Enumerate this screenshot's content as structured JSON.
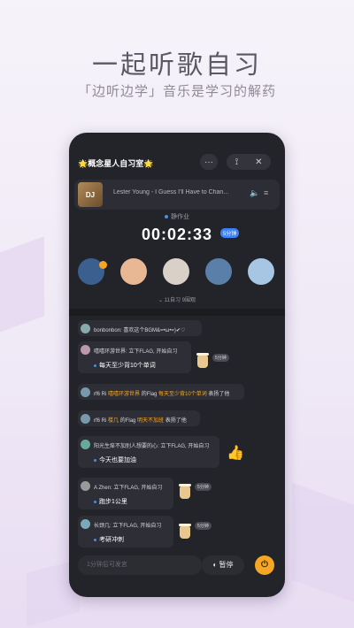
{
  "hero": {
    "title": "一起听歌自习",
    "subtitle": "「边听边学」音乐是学习的解药"
  },
  "room": {
    "title": "🌟概念星人自习室🌟",
    "more_label": "···",
    "pin_label": "⟟",
    "close_label": "✕"
  },
  "music": {
    "cover_text": "DJ",
    "track": "Lester Young - I Guess I'll Have to Chan...",
    "volume_icon": "speaker-icon",
    "list_icon": "list-icon"
  },
  "study": {
    "mode": "静作业",
    "timer": "00:02:33",
    "timer_badge": "5分钟",
    "stats": "11自习 9围观",
    "avatar_colors": [
      "#3b5f8f",
      "#e8b894",
      "#d9d0c7",
      "#5a7fa8",
      "#a7c6e4"
    ]
  },
  "chat": {
    "messages": [
      {
        "user": "bonbonbon",
        "text": "bonbonbon: 喜欢这个BGM&=•ω•=)✔♡"
      },
      {
        "user": "嘻嘻环游世界",
        "text": "嘻嘻环游世界: 立下FLAG, 开始自习",
        "sub": "每天至少背10个单词",
        "tag": "5分钟"
      },
      {
        "user": "rf6",
        "text_a": "rf6 Ri ",
        "hl": "嘻嘻环游世界",
        "text_b": " 的Flag ",
        "hl2": "每天至少背10个单词",
        "text_c": " 表扬了他"
      },
      {
        "user": "rf6",
        "text_a": "rf6 Ri ",
        "hl": "楼几",
        "text_b": " 的Flag ",
        "hl2": "明天不加班",
        "text_c": " 表扬了他"
      },
      {
        "user": "阳光生痒",
        "text": "阳光生痒不加别人想要的心: 立下FLAG, 开始自习",
        "sub": "今天也要加油"
      },
      {
        "user": "A Zhen",
        "text": "A Zhen: 立下FLAG, 开始自习",
        "sub": "跑步1公里",
        "tag": "5分钟"
      },
      {
        "user": "长颈几",
        "text": "长颈几: 立下FLAG, 开始自习",
        "sub": "考研冲刺",
        "tag": "5分钟"
      }
    ]
  },
  "composer": {
    "placeholder": "1分钟后可发言",
    "pause_label": "暂停",
    "power_icon": "⏻"
  }
}
